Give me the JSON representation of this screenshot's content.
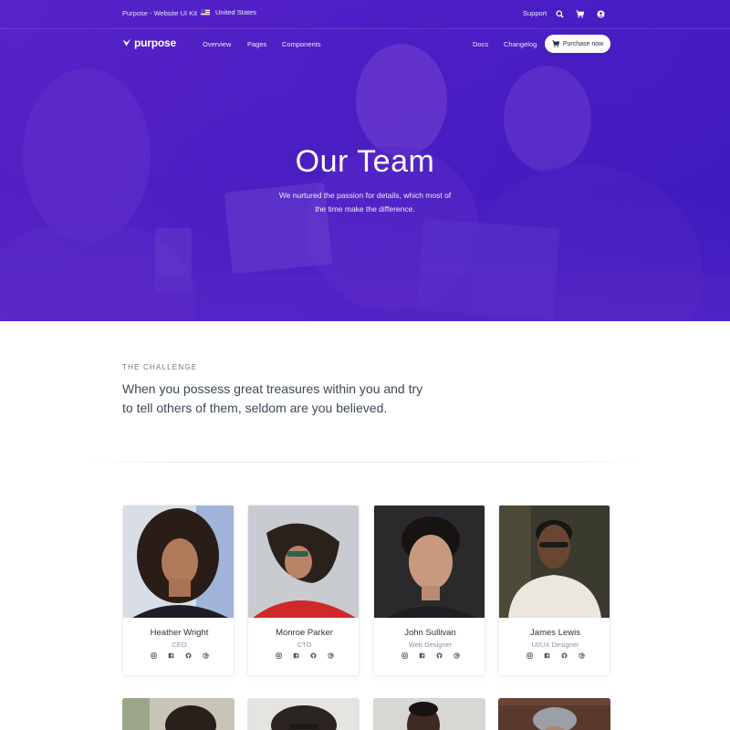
{
  "topbar": {
    "brand_text": "Purpose - Website UI Kit",
    "country": "United States",
    "support": "Support",
    "icons": [
      "search-icon",
      "cart-icon",
      "user-icon"
    ]
  },
  "navbar": {
    "logo_text": "purpose",
    "links": [
      "Overview",
      "Pages",
      "Components"
    ],
    "right_links": [
      "Docs",
      "Changelog"
    ],
    "purchase_label": "Purchase now"
  },
  "hero": {
    "title": "Our Team",
    "subtitle": "We nurtured the passion for details, which most of the time make the difference."
  },
  "challenge": {
    "eyebrow": "THE CHALLENGE",
    "quote": "When you possess great treasures within you and try to tell others of them, seldom are you believed."
  },
  "team": [
    {
      "name": "Heather Wright",
      "role": "CEO"
    },
    {
      "name": "Monroe Parker",
      "role": "CTO"
    },
    {
      "name": "John Sullivan",
      "role": "Web Designer"
    },
    {
      "name": "James Lewis",
      "role": "UI/UX Designer"
    }
  ],
  "social_icons": [
    "instagram-icon",
    "facebook-icon",
    "github-icon",
    "dribbble-icon"
  ],
  "colors": {
    "hero_primary": "#4b1fc4",
    "text_dark": "#3c4858",
    "muted": "#8a93a6"
  }
}
